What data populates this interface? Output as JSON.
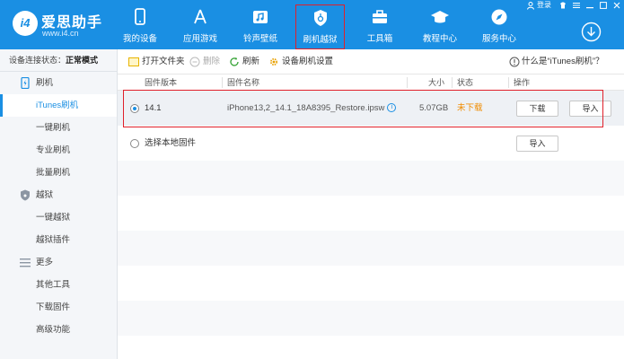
{
  "app": {
    "logo_mark": "i4",
    "title": "爱思助手",
    "subtitle": "www.i4.cn"
  },
  "nav": [
    {
      "label": "我的设备",
      "icon": "phone-icon"
    },
    {
      "label": "应用游戏",
      "icon": "app-store-icon"
    },
    {
      "label": "铃声壁纸",
      "icon": "music-icon"
    },
    {
      "label": "刷机越狱",
      "icon": "shield-icon",
      "active": true
    },
    {
      "label": "工具箱",
      "icon": "toolbox-icon"
    },
    {
      "label": "教程中心",
      "icon": "graduation-cap-icon"
    },
    {
      "label": "服务中心",
      "icon": "compass-icon"
    }
  ],
  "header_tools": {
    "login": "登录"
  },
  "sidebar": {
    "status_label": "设备连接状态：",
    "status_value": "正常模式",
    "items": [
      {
        "label": "刷机",
        "type": "group",
        "icon": "phone-flash-icon"
      },
      {
        "label": "iTunes刷机",
        "type": "sub",
        "active": true
      },
      {
        "label": "一键刷机",
        "type": "sub"
      },
      {
        "label": "专业刷机",
        "type": "sub"
      },
      {
        "label": "批量刷机",
        "type": "sub"
      },
      {
        "label": "越狱",
        "type": "group",
        "icon": "shield-small-icon"
      },
      {
        "label": "一键越狱",
        "type": "sub"
      },
      {
        "label": "越狱插件",
        "type": "sub"
      },
      {
        "label": "更多",
        "type": "group",
        "icon": "menu-icon"
      },
      {
        "label": "其他工具",
        "type": "sub"
      },
      {
        "label": "下载固件",
        "type": "sub"
      },
      {
        "label": "高级功能",
        "type": "sub"
      }
    ]
  },
  "toolbar": {
    "open_folder": "打开文件夹",
    "delete": "删除",
    "refresh": "刷新",
    "settings": "设备刷机设置",
    "help": "什么是“iTunes刷机”？"
  },
  "table": {
    "headers": {
      "version": "固件版本",
      "name": "固件名称",
      "size": "大小",
      "status": "状态",
      "action": "操作"
    },
    "rows": [
      {
        "version": "14.1",
        "name": "iPhone13,2_14.1_18A8395_Restore.ipsw",
        "size": "5.07GB",
        "status": "未下载",
        "download_label": "下载",
        "import_label": "导入",
        "selected": true
      }
    ],
    "local_row": {
      "label": "选择本地固件",
      "import_label": "导入"
    }
  },
  "colors": {
    "brand": "#1a8fe3",
    "highlight": "#e0202a",
    "status_pending": "#f08c00"
  }
}
